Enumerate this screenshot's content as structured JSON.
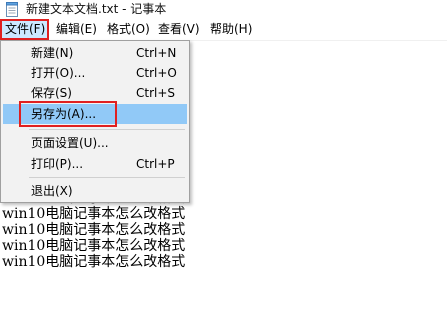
{
  "window": {
    "title": "新建文本文档.txt - 记事本"
  },
  "menubar": {
    "file": "文件(F)",
    "edit": "编辑(E)",
    "format": "格式(O)",
    "view": "查看(V)",
    "help": "帮助(H)"
  },
  "file_menu": {
    "new": {
      "label": "新建(N)",
      "shortcut": "Ctrl+N"
    },
    "open": {
      "label": "打开(O)...",
      "shortcut": "Ctrl+O"
    },
    "save": {
      "label": "保存(S)",
      "shortcut": "Ctrl+S"
    },
    "save_as": {
      "label": "另存为(A)...",
      "shortcut": ""
    },
    "page_setup": {
      "label": "页面设置(U)...",
      "shortcut": ""
    },
    "print": {
      "label": "打印(P)...",
      "shortcut": "Ctrl+P"
    },
    "exit": {
      "label": "退出(X)",
      "shortcut": ""
    }
  },
  "document": {
    "lines": [
      "win10电脑记事本怎么改格式",
      "win10电脑记事本怎么改格式",
      "win10电脑记事本怎么改格式",
      "win10电脑记事本怎么改格式",
      "win10电脑记事本怎么改格式"
    ]
  },
  "colors": {
    "highlight": "#91c9f7",
    "annotation_red": "#e02020",
    "menu_bg": "#f2f2f2"
  }
}
